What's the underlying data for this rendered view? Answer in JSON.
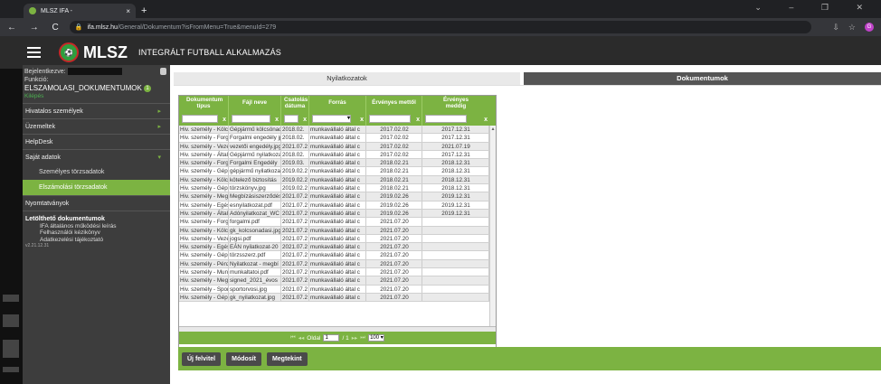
{
  "browser": {
    "tab_title": "MLSZ IFA -",
    "tab_close": "×",
    "new_tab": "+",
    "url_host": "ifa.mlsz.hu",
    "url_path": "/General/Dokumentum?isFromMenu=True&menuId=279",
    "nav_icons": "← → C",
    "window_controls": "⌄ – ❐ ✕",
    "toolbar_icons": [
      "⇩",
      "☆"
    ],
    "profile_initial": "G"
  },
  "app": {
    "brand": "MLSZ",
    "title": "INTEGRÁLT FUTBALL ALKALMAZÁS"
  },
  "sidebar": {
    "user_label": "Bejelentkezve:",
    "function_label": "Funkció:",
    "function_value": "ELSZAMOLASI_DOKUMENTUMOK",
    "function_badge": "1",
    "exit_link": "Kilépés",
    "items": [
      {
        "label": "Hivatalos személyek",
        "arrow": "▸"
      },
      {
        "label": "Üzemeltek",
        "arrow": "▸"
      },
      {
        "label": "HelpDesk",
        "arrow": ""
      },
      {
        "label": "Saját adatok",
        "arrow": "▾"
      }
    ],
    "subitems": [
      {
        "label": "Személyes törzsadatok"
      },
      {
        "label": "Elszámolási törzsadatok"
      }
    ],
    "item_forms": "Nyomtatványok",
    "downloads_title": "Letölthető dokumentumok",
    "downloads": [
      "IFA általános működési leírás",
      "Felhasználói kézikönyv",
      "Adatkezelési tájékoztató"
    ],
    "version": "v2.21.12.31"
  },
  "tabs": {
    "declarations": "Nyilatkozatok",
    "documents": "Dokumentumok"
  },
  "grid": {
    "columns": [
      "Dokumentum típus",
      "Fájl neve",
      "Csatolás dátuma",
      "Forrás",
      "Érvényes mettől",
      "Érvényes meddig"
    ],
    "filter_clear": "x",
    "filter_dropdown": "▾",
    "rows": [
      [
        "Hiv. személy - Kölcs",
        "Gépjármű kölcsönadási",
        "2018.02.",
        "munkavállaló által c",
        "2017.02.02",
        "2017.12.31"
      ],
      [
        "Hiv. személy - Forg",
        "Forgalmi engedély jpg",
        "2018.02.",
        "munkavállaló által c",
        "2017.02.02",
        "2017.12.31"
      ],
      [
        "Hiv. személy - Veze",
        "vezetői engedély.jpg",
        "2021.07.2",
        "munkavállaló által c",
        "2017.02.02",
        "2021.07.19"
      ],
      [
        "Hiv. személy - Általá",
        "Gépjármű nyilatkozat",
        "2018.02.",
        "munkavállaló által c",
        "2017.02.02",
        "2017.12.31"
      ],
      [
        "Hiv. személy - Forg",
        "Forgalmi Engedély",
        "2019.03.",
        "munkavállaló által c",
        "2018.02.21",
        "2018.12.31"
      ],
      [
        "Hiv. személy - Gép",
        "gépjármű nyilatkozat",
        "2019.02.2",
        "munkavállaló által c",
        "2018.02.21",
        "2018.12.31"
      ],
      [
        "Hiv. személy - Kölc",
        "kötelező biztosítás",
        "2019.02.2",
        "munkavállaló által c",
        "2018.02.21",
        "2018.12.31"
      ],
      [
        "Hiv. személy - Gép",
        "törzskönyv.jpg",
        "2019.02.2",
        "munkavállaló által c",
        "2018.02.21",
        "2018.12.31"
      ],
      [
        "Hiv. személy - Megl",
        "Megbízásiszerződés",
        "2021.07.2",
        "munkavállaló által c",
        "2019.02.26",
        "2019.12.31"
      ],
      [
        "Hiv. személy - Egés",
        "esnyilatkozat.pdf",
        "2021.07.2",
        "munkavállaló által c",
        "2019.02.26",
        "2019.12.31"
      ],
      [
        "Hiv. személy - Általá",
        "Adónyilatkozat_WC",
        "2021.07.2",
        "munkavállaló által c",
        "2019.02.26",
        "2019.12.31"
      ],
      [
        "Hiv. személy - Forg",
        "forgalmi.pdf",
        "2021.07.2",
        "munkavállaló által c",
        "2021.07.20",
        ""
      ],
      [
        "Hiv. személy - Kölcs",
        "gk_kolcsonadasi.jpg",
        "2021.07.2",
        "munkavállaló által c",
        "2021.07.20",
        ""
      ],
      [
        "Hiv. személy - Veze",
        "jogsi.pdf",
        "2021.07.2",
        "munkavállaló által c",
        "2021.07.20",
        ""
      ],
      [
        "Hiv. személy - Egés",
        "EÁN nyilatkozat-20",
        "2021.07.2",
        "munkavállaló által c",
        "2021.07.20",
        ""
      ],
      [
        "Hiv. személy - Gép",
        "törzsszerz.pdf",
        "2021.07.2",
        "munkavállaló által c",
        "2021.07.20",
        ""
      ],
      [
        "Hiv. személy - Pénz",
        "Nyilatkozat - megbí",
        "2021.07.2",
        "munkavállaló által c",
        "2021.07.20",
        ""
      ],
      [
        "Hiv. személy - Mun",
        "munkaltatoi.pdf",
        "2021.07.2",
        "munkavállaló által c",
        "2021.07.20",
        ""
      ],
      [
        "Hiv. személy - Megl",
        "signed_2021_évos",
        "2021.07.2",
        "munkavállaló által c",
        "2021.07.20",
        ""
      ],
      [
        "Hiv. személy - Spor",
        "sportorvosi.jpg",
        "2021.07.2",
        "munkavállaló által c",
        "2021.07.20",
        ""
      ],
      [
        "Hiv. személy - Gép",
        "gk_nyilatkozat.jpg",
        "2021.07.2",
        "munkavállaló által c",
        "2021.07.20",
        ""
      ]
    ],
    "pager": {
      "first": "⏮",
      "prev": "◂◂",
      "page_label": "Oldal",
      "page_value": "1",
      "of_label": "/ 1",
      "next": "▸▸",
      "last": "⏭",
      "page_size": "100 ▾"
    }
  },
  "buttons": {
    "new": "Új felvitel",
    "edit": "Módosít",
    "view": "Megtekint"
  },
  "colors": {
    "accent": "#7cb342",
    "sidebar": "#3d3d3d"
  }
}
